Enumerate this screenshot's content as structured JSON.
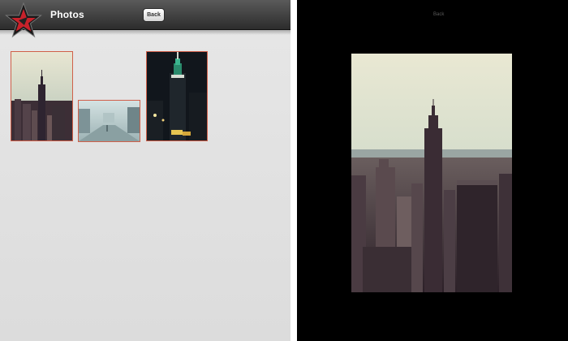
{
  "gallery": {
    "title": "Photos",
    "back_label": "Back",
    "logo_icon": "star-logo-icon",
    "thumbnails": [
      {
        "subject": "city-skyline-day"
      },
      {
        "subject": "foggy-street"
      },
      {
        "subject": "city-skyline-night"
      }
    ],
    "colors": {
      "toolbar": "#3a3a3a",
      "background": "#e2e2e2",
      "thumb_border": "#d0604a",
      "logo_red": "#c8222b"
    }
  },
  "viewer": {
    "back_label": "Back",
    "background": "#000000",
    "photo_subject": "city-skyline-day"
  }
}
